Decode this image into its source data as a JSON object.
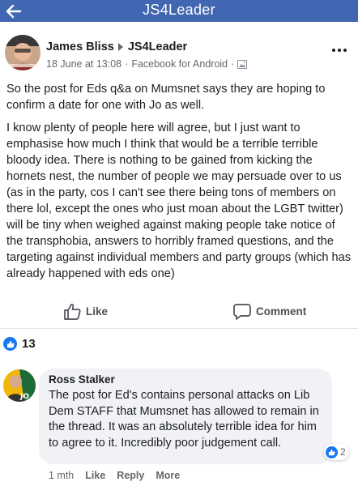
{
  "topbar": {
    "title": "JS4Leader",
    "back_icon": "arrow-left-icon"
  },
  "post": {
    "author": "James Bliss",
    "group": "JS4Leader",
    "date": "18 June at 13:08",
    "separator": "·",
    "source": "Facebook for Android",
    "separator2": "·",
    "paragraphs": [
      "So the post for Eds q&a on Mumsnet says they are hoping to confirm a date for one with Jo as well.",
      "I know plenty of people here will agree, but I just want to emphasise how much I think that would be a terrible terrible bloody idea. There is nothing to be gained from kicking the hornets nest, the number of people we may persuade over to us (as in the party, cos I can't see there being tons of members on there lol, except the ones who just moan about the LGBT twitter) will be tiny when weighed against making people take notice of the transphobia, answers to horribly framed questions, and the targeting against individual members and party groups (which has already happened with eds one)"
    ]
  },
  "actions": {
    "like_label": "Like",
    "comment_label": "Comment"
  },
  "reactions": {
    "count": "13"
  },
  "comment": {
    "author": "Ross Stalker",
    "text": "The post for Ed's contains personal attacks on Lib Dem STAFF that Mumsnet has allowed to remain in the thread. It was an absolutely terrible idea for him to agree to it. Incredibly poor judgement call.",
    "reaction_count": "2",
    "avatar_badge": "JO",
    "time": "1 mth",
    "like_label": "Like",
    "reply_label": "Reply",
    "more_label": "More"
  },
  "colors": {
    "brand": "#4267b2",
    "like_blue": "#1877f2",
    "bubble": "#f0f2f5",
    "meta_grey": "#616770"
  }
}
